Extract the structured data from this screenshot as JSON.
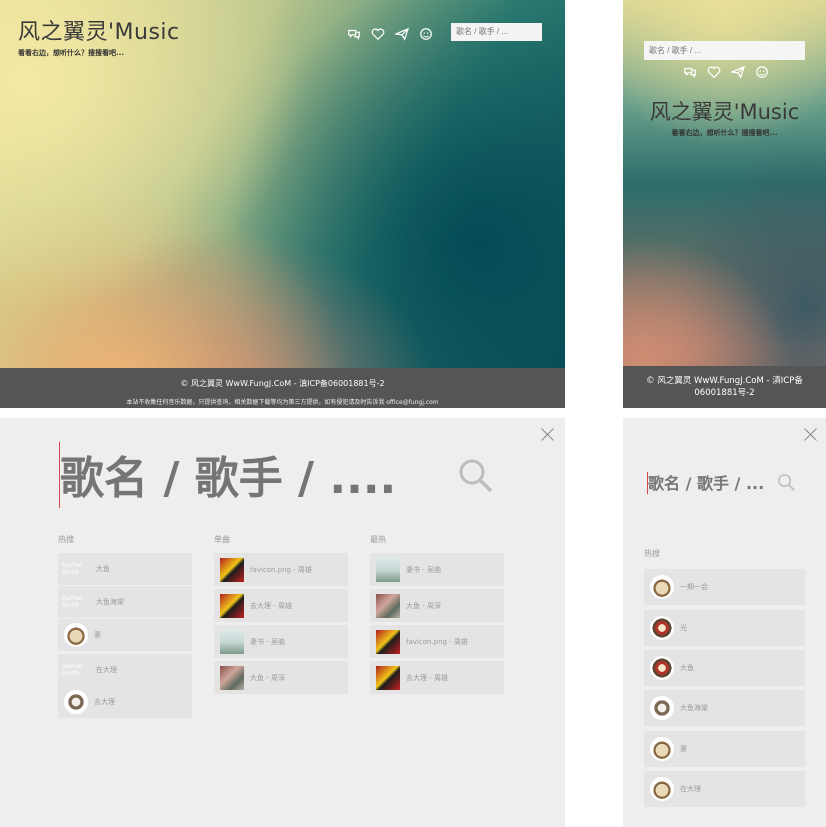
{
  "desktop": {
    "brand_title": "风之翼灵'Music",
    "brand_sub": "看看右边，想听什么？搜搜看吧...",
    "icons": [
      "chat-icon",
      "heart-icon",
      "paper-plane-icon",
      "smiley-icon"
    ],
    "search_placeholder": "歌名 / 歌手 / ...",
    "footer_line1": "© 风之翼灵 WwW.FungJ.CoM - 滇ICP备06001881号-2",
    "footer_line2": "本站不收集任何音乐数据，只提供查询，相关数据下载等均为第三方提供，如有侵犯请及时告诉我 office@fungj.com"
  },
  "mobile": {
    "search_placeholder": "歌名 / 歌手 / ...",
    "brand_title": "风之翼灵'Music",
    "brand_sub": "看看右边，想听什么？搜搜看吧...",
    "footer_text": "© 风之翼灵 WwW.FungJ.CoM - 滇ICP备06001881号-2"
  },
  "overlay": {
    "placeholder": "歌名 / 歌手 / ....",
    "columns": [
      {
        "title": "热搜",
        "items": [
          {
            "thumb_text": "Rachel Smith",
            "label": "大鱼"
          },
          {
            "thumb_text": "Rachel Smith",
            "label": "大鱼海棠"
          },
          {
            "thumb": "dog-avatar",
            "label": "妻"
          },
          {
            "thumb_text": "Rachel Smith",
            "label": "在大理"
          },
          {
            "thumb": "owl-avatar",
            "label": "去大理"
          }
        ]
      },
      {
        "title": "单曲",
        "items": [
          {
            "thumb": "favicon-cover",
            "label": "favicon.png - 周雄"
          },
          {
            "thumb": "favicon-cover",
            "label": "去大理 - 周雄"
          },
          {
            "thumb": "landscape-cover",
            "label": "妻书 - 吴脑"
          },
          {
            "thumb": "fish-cover",
            "label": "大鱼 - 周深"
          }
        ]
      },
      {
        "title": "最热",
        "items": [
          {
            "thumb": "landscape-cover",
            "label": "妻书 - 吴脑"
          },
          {
            "thumb": "fish-cover",
            "label": "大鱼 - 周深"
          },
          {
            "thumb": "favicon-cover",
            "label": "favicon.png - 周雄"
          },
          {
            "thumb": "favicon-cover",
            "label": "去大理 - 周雄"
          }
        ]
      }
    ]
  },
  "overlay_mobile": {
    "placeholder": "歌名 / 歌手 / ...",
    "title": "热搜",
    "items": [
      {
        "thumb": "dog-avatar",
        "label": "一期一会"
      },
      {
        "thumb": "bird-avatar",
        "label": "光"
      },
      {
        "thumb": "bird-avatar",
        "label": "大鱼"
      },
      {
        "thumb": "owl-avatar",
        "label": "大鱼海棠"
      },
      {
        "thumb": "dog-avatar",
        "label": "妻"
      },
      {
        "thumb": "dog-avatar",
        "label": "在大理"
      }
    ]
  }
}
